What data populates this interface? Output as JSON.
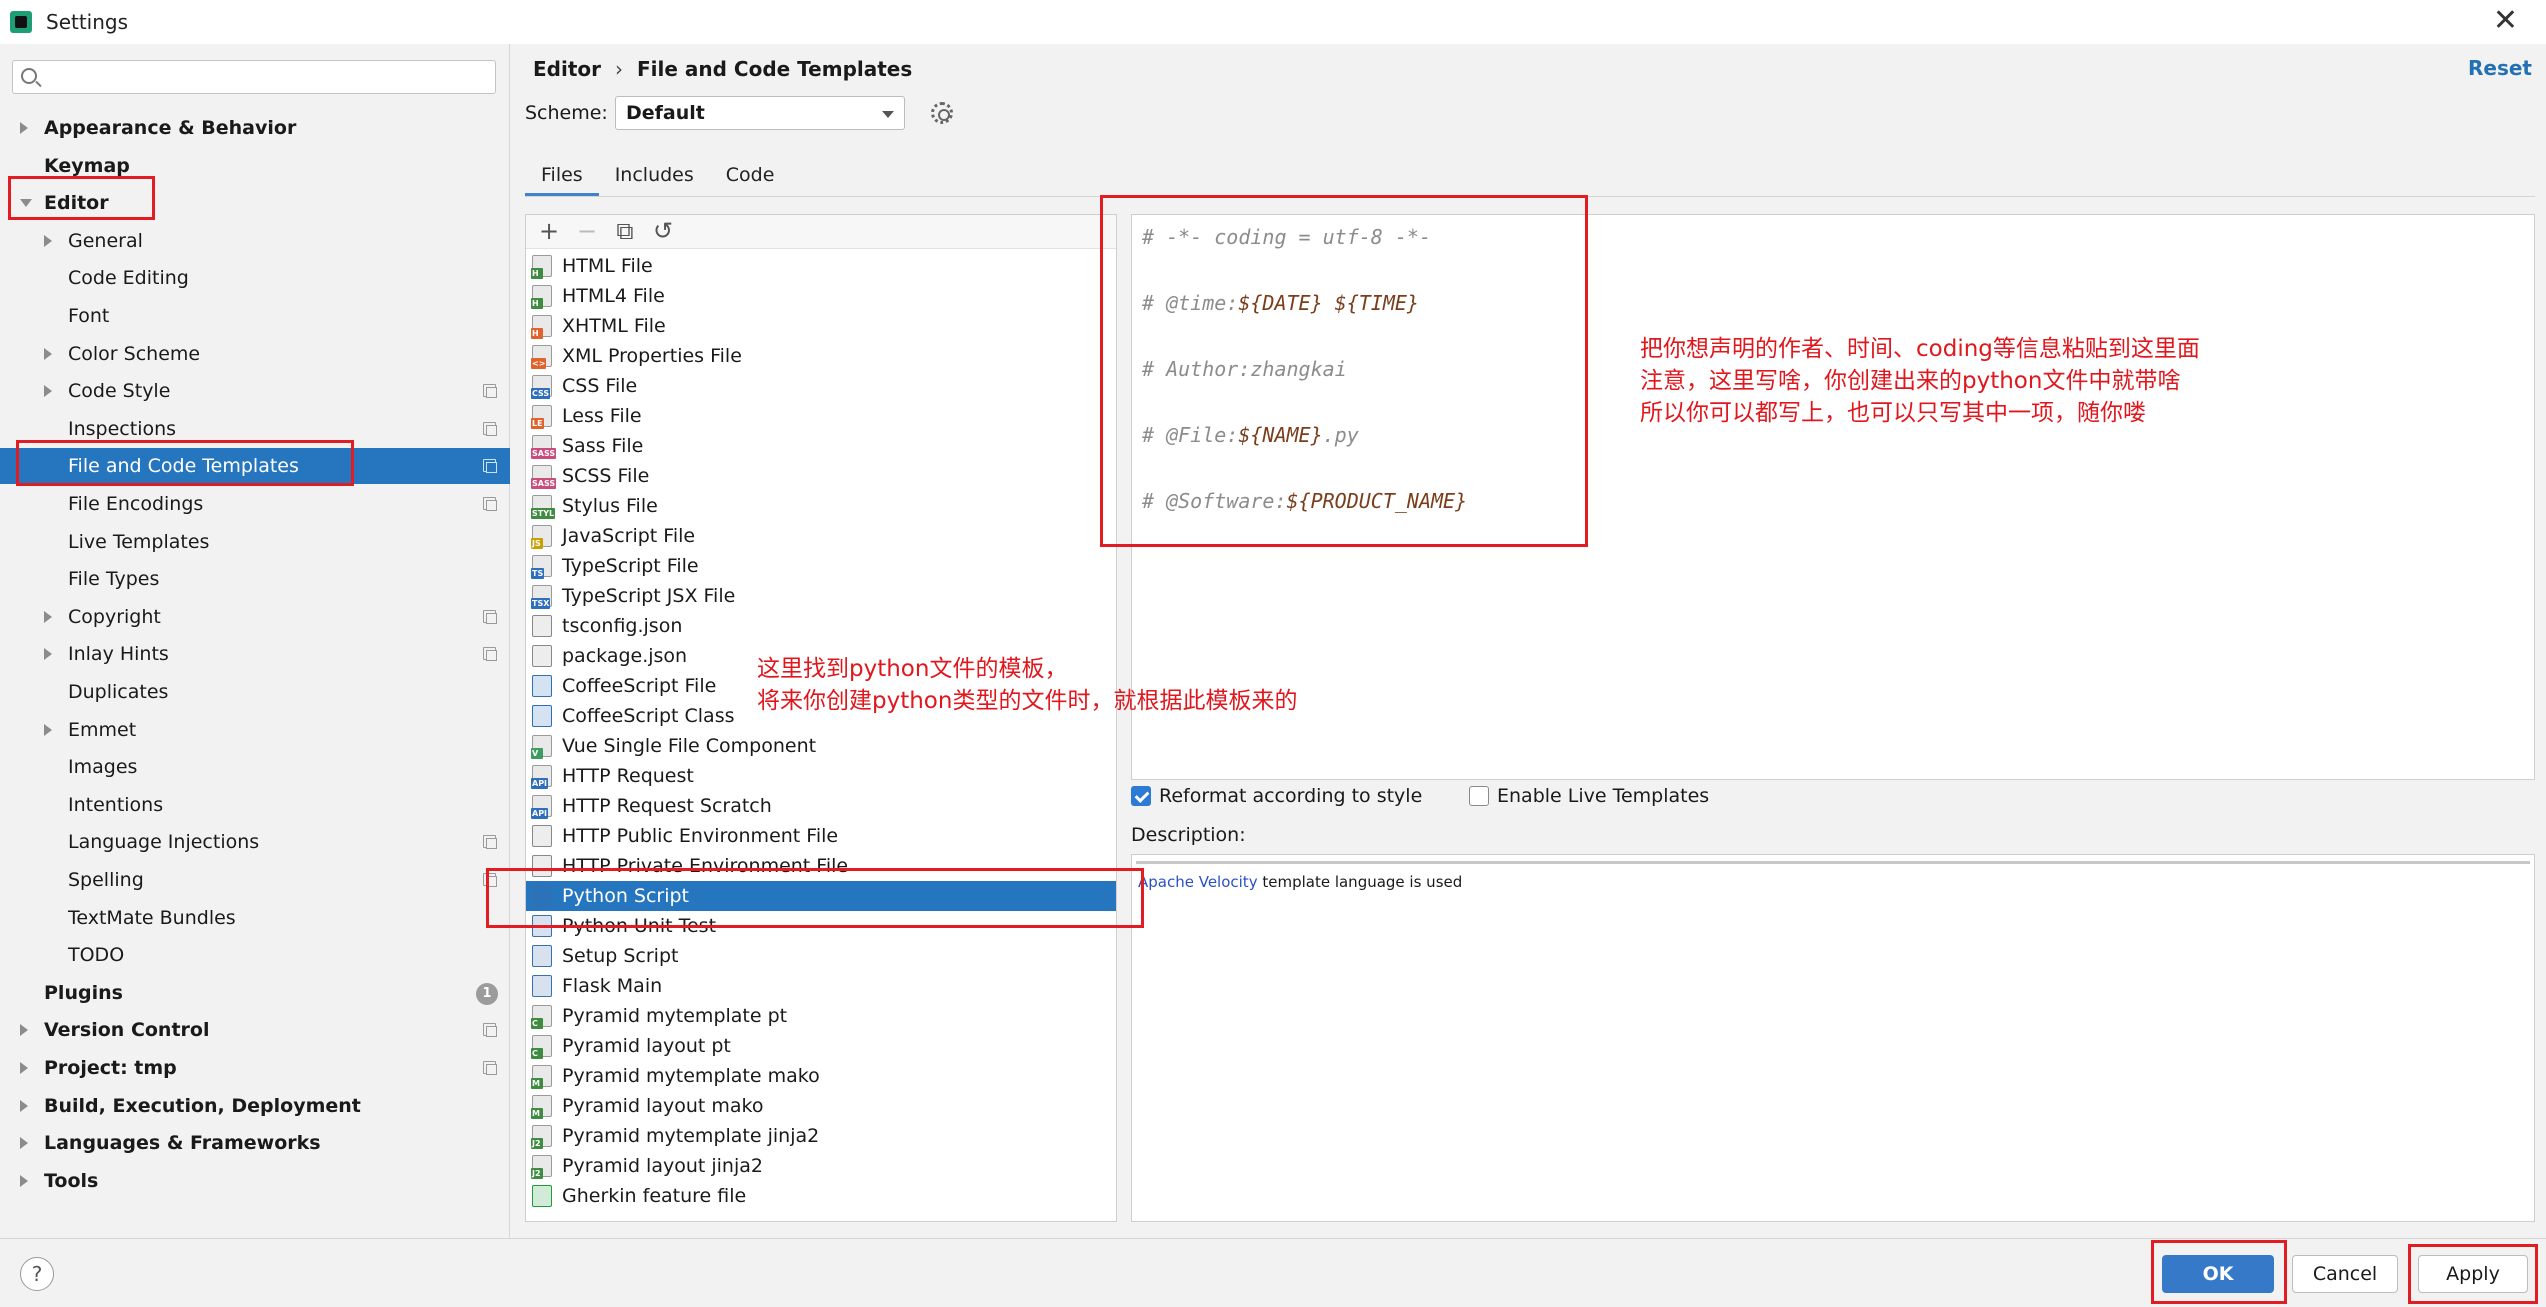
{
  "window": {
    "title": "Settings"
  },
  "search": {
    "placeholder": ""
  },
  "sidebar": {
    "items": [
      {
        "label": "Appearance & Behavior",
        "level": 0,
        "arrow": "right",
        "bold": true
      },
      {
        "label": "Keymap",
        "level": 0,
        "arrow": "",
        "bold": true
      },
      {
        "label": "Editor",
        "level": 0,
        "arrow": "down",
        "bold": true
      },
      {
        "label": "General",
        "level": 1,
        "arrow": "right"
      },
      {
        "label": "Code Editing",
        "level": 1,
        "arrow": ""
      },
      {
        "label": "Font",
        "level": 1,
        "arrow": ""
      },
      {
        "label": "Color Scheme",
        "level": 1,
        "arrow": "right"
      },
      {
        "label": "Code Style",
        "level": 1,
        "arrow": "right",
        "badge": "copy"
      },
      {
        "label": "Inspections",
        "level": 1,
        "arrow": "",
        "badge": "copy"
      },
      {
        "label": "File and Code Templates",
        "level": 1,
        "arrow": "",
        "badge": "copy",
        "selected": true
      },
      {
        "label": "File Encodings",
        "level": 1,
        "arrow": "",
        "badge": "copy"
      },
      {
        "label": "Live Templates",
        "level": 1,
        "arrow": ""
      },
      {
        "label": "File Types",
        "level": 1,
        "arrow": ""
      },
      {
        "label": "Copyright",
        "level": 1,
        "arrow": "right",
        "badge": "copy"
      },
      {
        "label": "Inlay Hints",
        "level": 1,
        "arrow": "right",
        "badge": "copy"
      },
      {
        "label": "Duplicates",
        "level": 1,
        "arrow": ""
      },
      {
        "label": "Emmet",
        "level": 1,
        "arrow": "right"
      },
      {
        "label": "Images",
        "level": 1,
        "arrow": ""
      },
      {
        "label": "Intentions",
        "level": 1,
        "arrow": ""
      },
      {
        "label": "Language Injections",
        "level": 1,
        "arrow": "",
        "badge": "copy"
      },
      {
        "label": "Spelling",
        "level": 1,
        "arrow": "",
        "badge": "copy"
      },
      {
        "label": "TextMate Bundles",
        "level": 1,
        "arrow": ""
      },
      {
        "label": "TODO",
        "level": 1,
        "arrow": ""
      },
      {
        "label": "Plugins",
        "level": 0,
        "arrow": "",
        "bold": true,
        "count": "1"
      },
      {
        "label": "Version Control",
        "level": 0,
        "arrow": "right",
        "bold": true,
        "badge": "copy"
      },
      {
        "label": "Project: tmp",
        "level": 0,
        "arrow": "right",
        "bold": true,
        "badge": "copy"
      },
      {
        "label": "Build, Execution, Deployment",
        "level": 0,
        "arrow": "right",
        "bold": true
      },
      {
        "label": "Languages & Frameworks",
        "level": 0,
        "arrow": "right",
        "bold": true
      },
      {
        "label": "Tools",
        "level": 0,
        "arrow": "right",
        "bold": true
      }
    ]
  },
  "header": {
    "breadcrumb": [
      "Editor",
      "File and Code Templates"
    ],
    "separator": "›",
    "reset_label": "Reset"
  },
  "scheme": {
    "label": "Scheme:",
    "value": "Default"
  },
  "tabs": [
    {
      "label": "Files",
      "active": true
    },
    {
      "label": "Includes",
      "active": false
    },
    {
      "label": "Code",
      "active": false
    }
  ],
  "toolbar": {
    "add": "+",
    "remove": "−",
    "copy": "⧉",
    "reset": "↺"
  },
  "templates": [
    {
      "label": "HTML File",
      "tag": "H",
      "color": "#3d8c40"
    },
    {
      "label": "HTML4 File",
      "tag": "H",
      "color": "#3d8c40"
    },
    {
      "label": "XHTML File",
      "tag": "H",
      "color": "#e0632d"
    },
    {
      "label": "XML Properties File",
      "tag": "<>",
      "color": "#e0632d"
    },
    {
      "label": "CSS File",
      "tag": "CSS",
      "color": "#2d6fba"
    },
    {
      "label": "Less File",
      "tag": "LE",
      "color": "#e0632d"
    },
    {
      "label": "Sass File",
      "tag": "SASS",
      "color": "#c94d7c"
    },
    {
      "label": "SCSS File",
      "tag": "SASS",
      "color": "#c94d7c"
    },
    {
      "label": "Stylus File",
      "tag": "STYL",
      "color": "#3d8c40"
    },
    {
      "label": "JavaScript File",
      "tag": "JS",
      "color": "#c9a000"
    },
    {
      "label": "TypeScript File",
      "tag": "TS",
      "color": "#2d6fba"
    },
    {
      "label": "TypeScript JSX File",
      "tag": "TSX",
      "color": "#2d6fba"
    },
    {
      "label": "tsconfig.json",
      "tag": "",
      "color": "#888888"
    },
    {
      "label": "package.json",
      "tag": "",
      "color": "#888888"
    },
    {
      "label": "CoffeeScript File",
      "tag": "",
      "color": "#2d6fba"
    },
    {
      "label": "CoffeeScript Class",
      "tag": "",
      "color": "#2d6fba"
    },
    {
      "label": "Vue Single File Component",
      "tag": "V",
      "color": "#3d9c60"
    },
    {
      "label": "HTTP Request",
      "tag": "API",
      "color": "#2d6fba"
    },
    {
      "label": "HTTP Request Scratch",
      "tag": "API",
      "color": "#2d6fba"
    },
    {
      "label": "HTTP Public Environment File",
      "tag": "",
      "color": "#888888"
    },
    {
      "label": "HTTP Private Environment File",
      "tag": "",
      "color": "#888888"
    },
    {
      "label": "Python Script",
      "tag": "",
      "color": "#3a6fae",
      "selected": true
    },
    {
      "label": "Python Unit Test",
      "tag": "",
      "color": "#3a6fae"
    },
    {
      "label": "Setup Script",
      "tag": "",
      "color": "#3a6fae"
    },
    {
      "label": "Flask Main",
      "tag": "",
      "color": "#3a6fae"
    },
    {
      "label": "Pyramid mytemplate pt",
      "tag": "C",
      "color": "#3d8c40"
    },
    {
      "label": "Pyramid layout pt",
      "tag": "C",
      "color": "#3d8c40"
    },
    {
      "label": "Pyramid mytemplate mako",
      "tag": "M",
      "color": "#3d8c40"
    },
    {
      "label": "Pyramid layout mako",
      "tag": "M",
      "color": "#3d8c40"
    },
    {
      "label": "Pyramid mytemplate jinja2",
      "tag": "J2",
      "color": "#3d8c40"
    },
    {
      "label": "Pyramid layout jinja2",
      "tag": "J2",
      "color": "#3d8c40"
    },
    {
      "label": "Gherkin feature file",
      "tag": "",
      "color": "#1f9d3c"
    }
  ],
  "editor": {
    "lines": [
      {
        "plain": "# -*- coding = utf-8 -*-",
        "var": ""
      },
      {
        "plain": "# @time:",
        "var": "${DATE} ${TIME}"
      },
      {
        "plain": "# Author:zhangkai",
        "var": ""
      },
      {
        "plain": "# @File:",
        "var": "${NAME}",
        "after": ".py"
      },
      {
        "plain": "# @Software:",
        "var": "${PRODUCT_NAME}"
      }
    ]
  },
  "options": {
    "reformat_label": "Reformat according to style",
    "reformat_checked": true,
    "live_templates_label": "Enable Live Templates",
    "live_templates_checked": false
  },
  "description": {
    "label": "Description:",
    "link_text": "Apache Velocity",
    "text": " template language is used"
  },
  "footer": {
    "help_label": "?",
    "ok_label": "OK",
    "cancel_label": "Cancel",
    "apply_label": "Apply"
  },
  "annotations": {
    "note_editor": [
      "把你想声明的作者、时间、coding等信息粘贴到这里面",
      "注意，这里写啥，你创建出来的python文件中就带啥",
      "所以你可以都写上，也可以只写其中一项，随你喽"
    ],
    "note_list": [
      "这里找到python文件的模板，",
      "将来你创建python类型的文件时，就根据此模板来的"
    ],
    "color": "#e21c23"
  }
}
